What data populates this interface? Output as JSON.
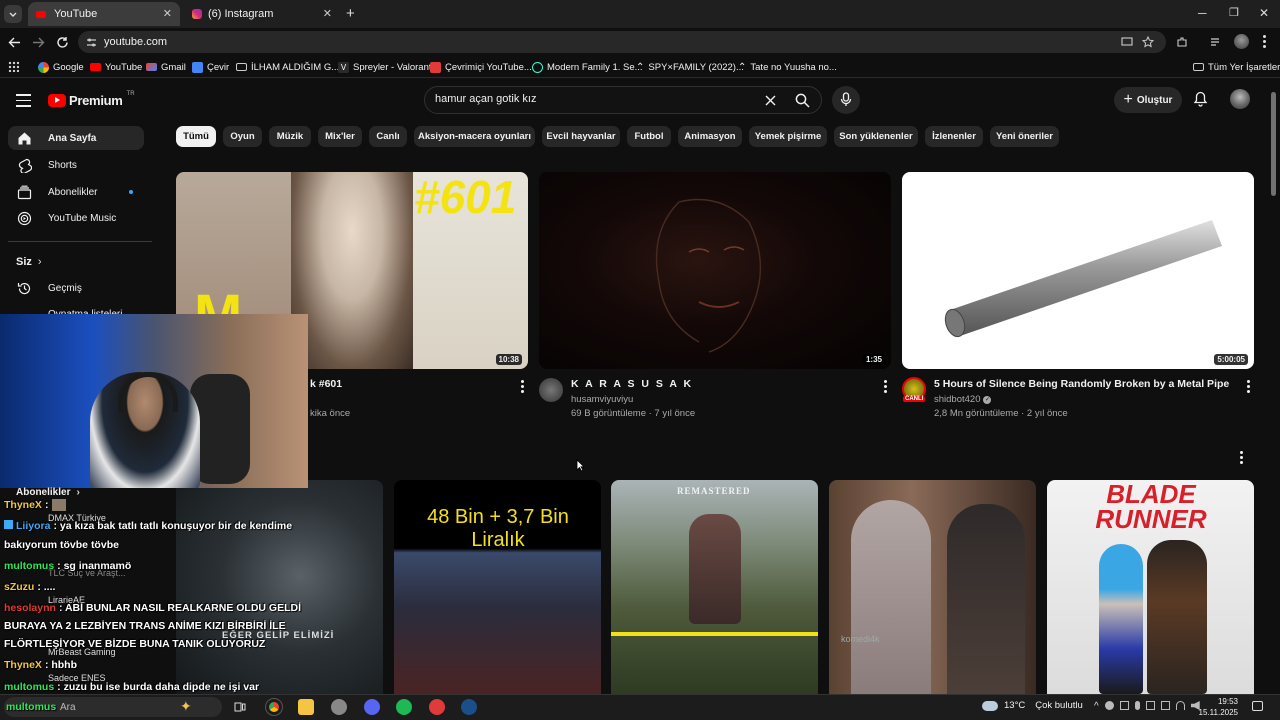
{
  "browser": {
    "tabs": [
      {
        "title": "YouTube",
        "active": true
      },
      {
        "title": "(6) Instagram",
        "active": false
      }
    ],
    "new_tab": "+",
    "url": "youtube.com",
    "bookmarks": [
      {
        "label": "Google"
      },
      {
        "label": "YouTube"
      },
      {
        "label": "Gmail"
      },
      {
        "label": "Çevir"
      },
      {
        "label": "İLHAM ALDIĞIM G..."
      },
      {
        "label": "Spreyler - Valorant"
      },
      {
        "label": "Çevrimiçi YouTube..."
      },
      {
        "label": "Modern Family 1. Se..."
      },
      {
        "label": "SPY×FAMILY (2022)..."
      },
      {
        "label": "Tate no Yuusha no..."
      }
    ],
    "all_bookmarks": "Tüm Yer İşaretleri"
  },
  "youtube": {
    "logo": "Premium",
    "logo_region": "TR",
    "search_value": "hamur açan gotik kız",
    "create_label": "Oluştur",
    "chips": [
      "Tümü",
      "Oyun",
      "Müzik",
      "Mix'ler",
      "Canlı",
      "Aksiyon-macera oyunları",
      "Evcil hayvanlar",
      "Futbol",
      "Animasyon",
      "Yemek pişirme",
      "Son yüklenenler",
      "İzlenenler",
      "Yeni öneriler"
    ],
    "sidebar": {
      "items": [
        {
          "label": "Ana Sayfa",
          "icon": "home-icon"
        },
        {
          "label": "Shorts",
          "icon": "shorts-icon"
        },
        {
          "label": "Abonelikler",
          "icon": "subscriptions-icon"
        },
        {
          "label": "YouTube Music",
          "icon": "youtube-music-icon"
        }
      ],
      "you_label": "Siz",
      "history_label": "Geçmiş",
      "playlists_label": "Oynatma listeleri",
      "subs_header": "Abonelikler",
      "subs": [
        "DMAX Türkiye",
        "TLC Suç ve Araşt...",
        "LirarieAE",
        "MrBeast Gaming",
        "Sadece ENES"
      ]
    },
    "videos_row1": [
      {
        "title_visible": "k #601",
        "thumb_text": "#601",
        "duration": "10:38",
        "meta_visible": "kika önce"
      },
      {
        "title": "K A R A  S U S A K",
        "channel": "husamviyuviyu",
        "meta": "69 B görüntüleme · 7 yıl önce",
        "duration": "1:35"
      },
      {
        "title": "5 Hours of Silence Being Randomly Broken by a Metal Pipe",
        "channel": "shidbot420",
        "meta": "2,8 Mn görüntüleme · 2 yıl önce",
        "duration": "5:00:05",
        "avatar_badge": "CANLI"
      }
    ],
    "thumbs_row2": [
      {
        "overlay": "EĞER GELİP ELİMİZİ"
      },
      {
        "overlay": "48 Bin + 3,7 Bin Liralık"
      },
      {
        "overlay": "REMASTERED"
      },
      {
        "overlay": "komedi4k"
      },
      {
        "overlay": "BLADE RUNNER"
      }
    ]
  },
  "chat": [
    {
      "user": "ThyneX",
      "msg": ":",
      "color": "#f4c542"
    },
    {
      "user": "Liiyora",
      "msg": ": ya kıza bak tatlı tatlı konuşuyor bir de kendime",
      "color": "#3fa9f5"
    },
    {
      "user": "",
      "msg": "bakıyorum tövbe tövbe",
      "color": "#ffffff"
    },
    {
      "user": "multomus",
      "msg": ": sg inanmamö",
      "color": "#2ee65a"
    },
    {
      "user": "sZuzu",
      "msg": ": ....",
      "color": "#f4c542"
    },
    {
      "user": "hesolaynn",
      "msg": ": ABİ BUNLAR NASIL REALKARNE OLDU GELDİ",
      "color": "#e03a3a"
    },
    {
      "user": "",
      "msg": "BURAYA YA 2 LEZBİYEN TRANS ANİME KIZI BİRBİRİ İLE",
      "color": "#ffffff"
    },
    {
      "user": "",
      "msg": "FLÖRTLEŞİYOR VE BİZDE BUNA TANIK OLUYORUZ",
      "color": "#ffffff"
    },
    {
      "user": "ThyneX",
      "msg": ": hbhb",
      "color": "#f4c542"
    },
    {
      "user": "multomus",
      "msg": ": zuzu bu ise burda daha dipde ne işi var",
      "color": "#2ee65a"
    },
    {
      "user": "multomus",
      "msg": "",
      "color": "#2ee65a"
    }
  ],
  "taskbar": {
    "search_text": "Ara",
    "weather": "13°C",
    "weather_text": "Çok bulutlu",
    "time": "19:53",
    "date": "15.11.2025"
  }
}
